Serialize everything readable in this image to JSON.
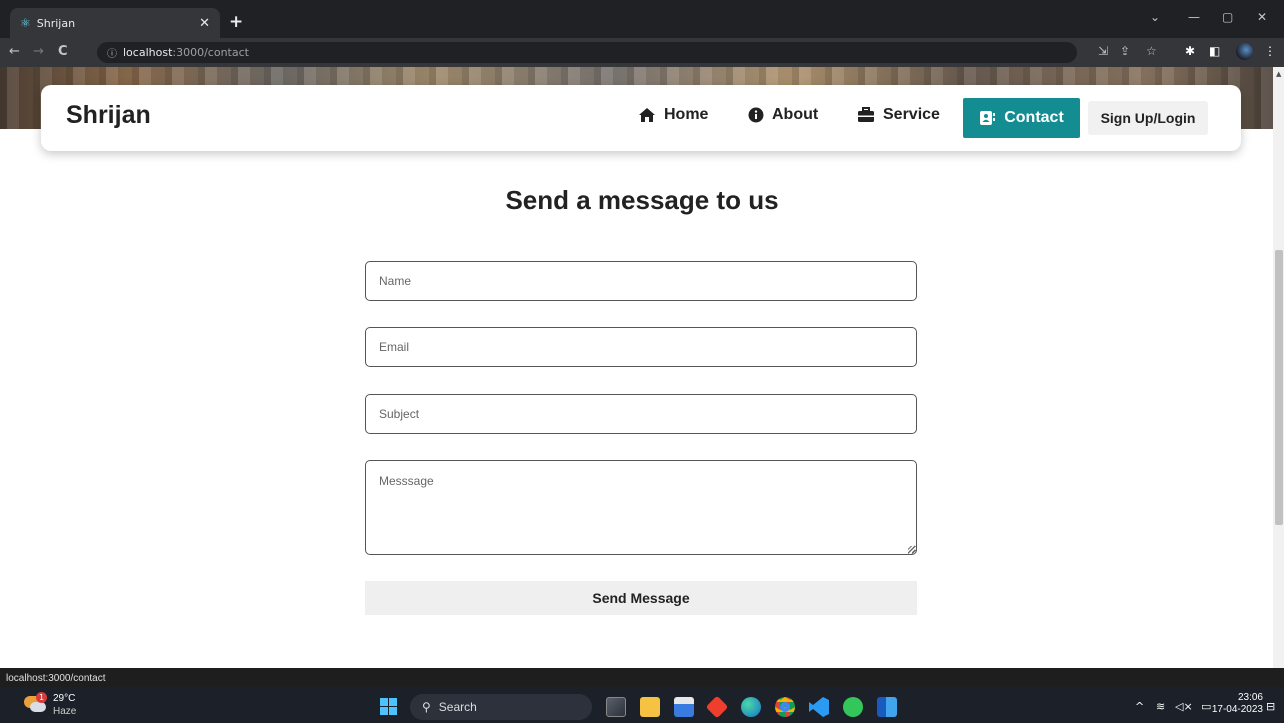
{
  "browser": {
    "tab_title": "Shrijan",
    "url_host": "localhost",
    "url_path": ":3000/contact",
    "status_url": "localhost:3000/contact"
  },
  "nav": {
    "brand": "Shrijan",
    "links": [
      {
        "label": "Home",
        "icon": "home-icon"
      },
      {
        "label": "About",
        "icon": "info-icon"
      },
      {
        "label": "Service",
        "icon": "briefcase-icon"
      },
      {
        "label": "Contact",
        "icon": "address-book-icon",
        "active": true
      }
    ],
    "login_label": "Sign Up/Login",
    "accent_color": "#138d91"
  },
  "form": {
    "heading": "Send a message to us",
    "name_placeholder": "Name",
    "email_placeholder": "Email",
    "subject_placeholder": "Subject",
    "message_placeholder": "Messsage",
    "submit_label": "Send Message"
  },
  "taskbar": {
    "weather_temp": "29°C",
    "weather_condition": "Haze",
    "weather_badge": "1",
    "search_label": "Search",
    "time": "23:06",
    "date": "17-04-2023"
  }
}
